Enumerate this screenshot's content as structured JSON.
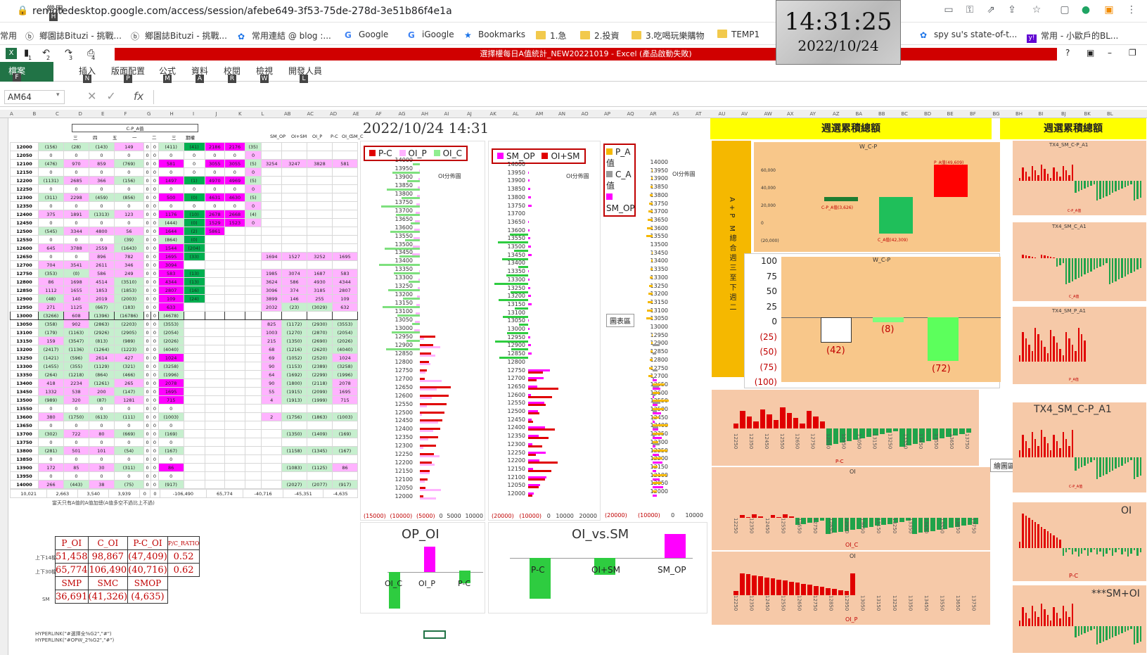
{
  "browser": {
    "url": "remotedesktop.google.com/access/session/afebe649-3f53-75de-278d-3e51b86f4e1a"
  },
  "bookmarks": [
    {
      "label": "常用",
      "icon": "none"
    },
    {
      "label": "鄉園誌Bituzi - 挑戰...",
      "icon": "logo-icon"
    },
    {
      "label": "鄉園誌Bituzi - 挑戰...",
      "icon": "logo-icon"
    },
    {
      "label": "常用連結 @ blog :...",
      "icon": "gear-icon"
    },
    {
      "label": "Google",
      "icon": "google-icon"
    },
    {
      "label": "iGoogle",
      "icon": "google-icon"
    },
    {
      "label": "Bookmarks",
      "icon": "star-icon"
    },
    {
      "label": "1.急",
      "icon": "folder-icon"
    },
    {
      "label": "2.投資",
      "icon": "folder-icon"
    },
    {
      "label": "3.吃喝玩樂購物",
      "icon": "folder-icon"
    },
    {
      "label": "TEMP1",
      "icon": "folder-icon"
    },
    {
      "label": "spy su's state-of-t...",
      "icon": "gear-icon"
    },
    {
      "label": "常用 - 小歐戶的BL...",
      "icon": "yahoo-icon"
    }
  ],
  "clock": {
    "time": "14:31:25",
    "date": "2022/10/24"
  },
  "excel": {
    "title": "選擇權每日A值統計_NEW20221019 - Excel (產品啟動失敗)",
    "qat": [
      "1",
      "2",
      "3",
      "4"
    ],
    "tabs": [
      {
        "label": "檔案",
        "key": "F"
      },
      {
        "label": "常用",
        "key": "H"
      },
      {
        "label": "插入",
        "key": "N"
      },
      {
        "label": "版面配置",
        "key": "P"
      },
      {
        "label": "公式",
        "key": "M"
      },
      {
        "label": "資料",
        "key": "A"
      },
      {
        "label": "校閱",
        "key": "R"
      },
      {
        "label": "檢視",
        "key": "W"
      },
      {
        "label": "開發人員",
        "key": "L"
      }
    ],
    "namebox": "AM64",
    "fx": "fx",
    "col_headers": [
      "A",
      "B",
      "C",
      "D",
      "E",
      "F",
      "G",
      "H",
      "I",
      "J",
      "K",
      "L",
      "AB",
      "AC",
      "AD",
      "AE",
      "AF",
      "AG",
      "AH",
      "AI",
      "AJ",
      "AK",
      "AL",
      "AM",
      "AN",
      "AO",
      "AP",
      "AQ",
      "AR",
      "AS",
      "AT",
      "AU",
      "AV",
      "AW",
      "AX",
      "AY",
      "AZ",
      "BA",
      "BB",
      "BC",
      "BD",
      "BE",
      "BF",
      "BG",
      "BH",
      "BI",
      "BJ",
      "BK",
      "BL"
    ]
  },
  "sheet": {
    "header_labels": [
      "C-P_A值",
      "三",
      "四",
      "五",
      "一",
      "二",
      "三",
      "期權",
      "SM_OP",
      "OI+SM",
      "OI_P",
      "P-C",
      "OI_C",
      "SM_C"
    ],
    "rows": [
      [
        "12000",
        "(156)",
        "(28)",
        "(143)",
        "149",
        "0",
        "0",
        "(411)",
        "(41)",
        "2186",
        "2176",
        "(35)",
        "",
        "",
        "",
        ""
      ],
      [
        "12050",
        "0",
        "0",
        "0",
        "0",
        "0",
        "0",
        "0",
        "0",
        "0",
        "0",
        "0",
        "",
        "",
        "",
        ""
      ],
      [
        "12100",
        "(476)",
        "970",
        "859",
        "(769)",
        "0",
        "0",
        "581",
        "0",
        "3055",
        "3055",
        "(5)",
        "3254",
        "3247",
        "3828",
        "581"
      ],
      [
        "12150",
        "0",
        "0",
        "0",
        "0",
        "0",
        "0",
        "0",
        "0",
        "0",
        "0",
        "0",
        "",
        "",
        "",
        ""
      ],
      [
        "12200",
        "(1131)",
        "2685",
        "366",
        "(156)",
        "0",
        "0",
        "1497",
        "(1)",
        "4970",
        "4969",
        "(5)",
        "",
        "",
        "",
        ""
      ],
      [
        "12250",
        "0",
        "0",
        "0",
        "0",
        "0",
        "0",
        "0",
        "0",
        "0",
        "0",
        "0",
        "",
        "",
        "",
        ""
      ],
      [
        "12300",
        "(311)",
        "2298",
        "(459)",
        "(856)",
        "0",
        "0",
        "500",
        "(0)",
        "4631",
        "4630",
        "(5)",
        "",
        "",
        "",
        ""
      ],
      [
        "12350",
        "0",
        "0",
        "0",
        "0",
        "0",
        "0",
        "0",
        "0",
        "0",
        "0",
        "0",
        "",
        "",
        "",
        ""
      ],
      [
        "12400",
        "375",
        "1891",
        "(1313)",
        "123",
        "0",
        "0",
        "1176",
        "(10)",
        "2678",
        "2668",
        "(4)",
        "",
        "",
        "",
        ""
      ],
      [
        "12450",
        "0",
        "0",
        "0",
        "0",
        "0",
        "0",
        "(444)",
        "(0)",
        "1529",
        "1523",
        "0",
        "",
        "",
        "",
        ""
      ],
      [
        "12500",
        "(545)",
        "3344",
        "4800",
        "56",
        "0",
        "0",
        "1644",
        "(2)",
        "5861",
        "",
        "",
        "",
        "",
        "",
        ""
      ],
      [
        "12550",
        "0",
        "0",
        "0",
        "(39)",
        "0",
        "0",
        "(864)",
        "(0)",
        "",
        "",
        "",
        "",
        "",
        "",
        ""
      ],
      [
        "12600",
        "645",
        "3788",
        "2559",
        "(1643)",
        "0",
        "0",
        "1544",
        "(204)",
        "",
        "",
        "",
        "",
        "",
        "",
        ""
      ],
      [
        "12650",
        "0",
        "0",
        "896",
        "782",
        "0",
        "0",
        "1695",
        "(33)",
        "",
        "",
        "",
        "1694",
        "1527",
        "3252",
        "1695"
      ],
      [
        "12700",
        "704",
        "3541",
        "2611",
        "346",
        "0",
        "0",
        "3094",
        "",
        "",
        "",
        "",
        "",
        "",
        "",
        ""
      ],
      [
        "12750",
        "(353)",
        "(0)",
        "586",
        "249",
        "0",
        "0",
        "583",
        "(13)",
        "",
        "",
        "",
        "1985",
        "3074",
        "1687",
        "583"
      ],
      [
        "12800",
        "86",
        "1698",
        "4514",
        "(3510)",
        "0",
        "0",
        "4344",
        "(13)",
        "",
        "",
        "",
        "3624",
        "586",
        "4930",
        "4344"
      ],
      [
        "12850",
        "1112",
        "1655",
        "1853",
        "(1853)",
        "0",
        "0",
        "2807",
        "(16)",
        "",
        "",
        "",
        "3096",
        "374",
        "3185",
        "2807"
      ],
      [
        "12900",
        "(48)",
        "140",
        "2019",
        "(2003)",
        "0",
        "0",
        "109",
        "(24)",
        "",
        "",
        "",
        "3899",
        "146",
        "255",
        "109"
      ],
      [
        "12950",
        "271",
        "1125",
        "(667)",
        "(183)",
        "0",
        "0",
        "633",
        "",
        "",
        "",
        "",
        "2032",
        "(23)",
        "(3029)",
        "632"
      ],
      [
        "13000",
        "(3266)",
        "608",
        "(1396)",
        "(16786)",
        "0",
        "0",
        "(4678)",
        "",
        "",
        "",
        "",
        "",
        "",
        "",
        ""
      ],
      [
        "13050",
        "(358)",
        "902",
        "(2863)",
        "(2203)",
        "0",
        "0",
        "(3553)",
        "",
        "",
        "",
        "",
        "825",
        "(1172)",
        "(2930)",
        "(3553)"
      ],
      [
        "13100",
        "(179)",
        "(1163)",
        "(2926)",
        "(2905)",
        "0",
        "0",
        "(2054)",
        "",
        "",
        "",
        "",
        "1003",
        "(1270)",
        "(2870)",
        "(2054)"
      ],
      [
        "13150",
        "159",
        "(3547)",
        "(813)",
        "(989)",
        "0",
        "0",
        "(2026)",
        "",
        "",
        "",
        "",
        "215",
        "(1350)",
        "(2690)",
        "(2026)"
      ],
      [
        "13200",
        "(2417)",
        "(1136)",
        "(1264)",
        "(1223)",
        "0",
        "0",
        "(4040)",
        "",
        "",
        "",
        "",
        "68",
        "(1216)",
        "(2620)",
        "(4040)"
      ],
      [
        "13250",
        "(1421)",
        "(596)",
        "2614",
        "427",
        "0",
        "0",
        "1024",
        "",
        "",
        "",
        "",
        "69",
        "(1052)",
        "(2520)",
        "1024"
      ],
      [
        "13300",
        "(1455)",
        "(355)",
        "(1129)",
        "(321)",
        "0",
        "0",
        "(3258)",
        "",
        "",
        "",
        "",
        "90",
        "(1153)",
        "(2389)",
        "(3258)"
      ],
      [
        "13350",
        "(264)",
        "(1218)",
        "(864)",
        "(466)",
        "0",
        "0",
        "(1996)",
        "",
        "",
        "",
        "",
        "64",
        "(1692)",
        "(2299)",
        "(1996)"
      ],
      [
        "13400",
        "418",
        "2234",
        "(1261)",
        "265",
        "0",
        "0",
        "2078",
        "",
        "",
        "",
        "",
        "90",
        "(1800)",
        "(2118)",
        "2078"
      ],
      [
        "13450",
        "1332",
        "538",
        "200",
        "(147)",
        "0",
        "0",
        "1695",
        "",
        "",
        "",
        "",
        "55",
        "(1915)",
        "(2099)",
        "1695"
      ],
      [
        "13500",
        "(989)",
        "320",
        "(87)",
        "1281",
        "0",
        "0",
        "715",
        "",
        "",
        "",
        "",
        "4",
        "(1913)",
        "(1999)",
        "715"
      ],
      [
        "13550",
        "0",
        "0",
        "0",
        "0",
        "0",
        "0",
        "0",
        "",
        "",
        "",
        "",
        "",
        "",
        "",
        ""
      ],
      [
        "13600",
        "380",
        "(1750)",
        "(613)",
        "(111)",
        "0",
        "0",
        "(1003)",
        "",
        "",
        "",
        "",
        "2",
        "(1756)",
        "(1863)",
        "(1003)"
      ],
      [
        "13650",
        "0",
        "0",
        "0",
        "0",
        "0",
        "0",
        "0",
        "",
        "",
        "",
        "",
        "",
        "",
        "",
        ""
      ],
      [
        "13700",
        "(302)",
        "722",
        "80",
        "(669)",
        "0",
        "0",
        "(169)",
        "",
        "",
        "",
        "",
        "",
        "(1350)",
        "(1409)",
        "(169)"
      ],
      [
        "13750",
        "0",
        "0",
        "0",
        "0",
        "0",
        "0",
        "0",
        "",
        "",
        "",
        "",
        "",
        "",
        "",
        ""
      ],
      [
        "13800",
        "(281)",
        "501",
        "101",
        "(54)",
        "0",
        "0",
        "(167)",
        "",
        "",
        "",
        "",
        "",
        "(1158)",
        "(1345)",
        "(167)"
      ],
      [
        "13850",
        "0",
        "0",
        "0",
        "0",
        "0",
        "0",
        "0",
        "",
        "",
        "",
        "",
        "",
        "",
        "",
        ""
      ],
      [
        "13900",
        "172",
        "85",
        "30",
        "(311)",
        "0",
        "0",
        "86",
        "",
        "",
        "",
        "",
        "",
        "(1083)",
        "(1125)",
        "86"
      ],
      [
        "13950",
        "0",
        "0",
        "0",
        "0",
        "0",
        "0",
        "0",
        "",
        "",
        "",
        "",
        "",
        "",
        "",
        ""
      ],
      [
        "14000",
        "266",
        "(443)",
        "38",
        "(75)",
        "0",
        "0",
        "(917)",
        "",
        "",
        "",
        "",
        "",
        "(2027)",
        "(2077)",
        "(917)"
      ]
    ],
    "totals": [
      "10,021",
      "2,663",
      "3,540",
      "3,939",
      "0",
      "0",
      "-106,490",
      "65,774",
      "-40,716",
      "-45,351",
      "-4,635"
    ],
    "note": "當天只有A值的A值加總(A值多空不過比上不過)",
    "hyperlink1": "HYPERLINK(\"#選擇全%G2\",\"#\")",
    "hyperlink2": "HYPERLINK(\"#OPW_2%G2\",\"#\")"
  },
  "summary": {
    "headers": [
      "P_OI",
      "C_OI",
      "P-C_OI",
      "P/C_RATIO"
    ],
    "rows": [
      {
        "label": "上下14檔",
        "values": [
          "51,458",
          "98,867",
          "(47,409)",
          "0.52"
        ]
      },
      {
        "label": "上下30檔",
        "values": [
          "65,774",
          "106,490",
          "(40,716)",
          "0.62"
        ]
      }
    ],
    "sm_headers": [
      "SMP",
      "SMC",
      "SMOP"
    ],
    "sm_label": "SM",
    "sm_values": [
      "36,691",
      "(41,326)",
      "(4,635)"
    ]
  },
  "charts": {
    "datetime": "2022/10/24 14:31",
    "oi_legend": [
      "P-C",
      "OI_P",
      "OI_C"
    ],
    "oi_title": "OI分佈圖",
    "sm_legend": [
      "SM_OP",
      "OI+SM"
    ],
    "pa_legend": [
      "P_A值",
      "C_A值",
      "SM_OP"
    ],
    "strikes": [
      "14000",
      "13950",
      "13900",
      "13850",
      "13800",
      "13750",
      "13700",
      "13650",
      "13600",
      "13550",
      "13500",
      "13450",
      "13400",
      "13350",
      "13300",
      "13250",
      "13200",
      "13150",
      "13100",
      "13050",
      "13000",
      "12950",
      "12900",
      "12850",
      "12800",
      "12750",
      "12700",
      "12650",
      "12600",
      "12550",
      "12500",
      "12450",
      "12400",
      "12350",
      "12300",
      "12250",
      "12200",
      "12150",
      "12100",
      "12050",
      "12000"
    ],
    "oi_axis": [
      "(15000)",
      "(10000)",
      "(5000)",
      "0",
      "5000",
      "10000"
    ],
    "sm_axis": [
      "(20000)",
      "(10000)",
      "0",
      "10000",
      "20000"
    ],
    "pa_axis": [
      "(20000)",
      "(10000)",
      "0",
      "10000"
    ],
    "chart_area_label": "圖表區",
    "op_oi_title": "OP_OI",
    "op_oi_labels": [
      "OI_C",
      "OI_P",
      "P-C"
    ],
    "oi_vs_sm_title": "OI_vs.SM",
    "oi_vs_sm_labels": [
      "P-C",
      "OI+SM",
      "SM_OP"
    ],
    "week_title": "週選累積總額",
    "week_title2": "週選累積總額",
    "side_label": "A+P M總合週三至下週二",
    "wcp_title": "W_C-P",
    "wcp_labels": [
      "C-P_A值(3,626)",
      "C_A值(42,309)",
      "P_A值(49,609)"
    ],
    "small_axis": [
      "60,000",
      "40,000",
      "20,000",
      "0",
      "(20,000)",
      "(40,000)",
      "(60,000)"
    ],
    "wcp2_title": "W_C-P",
    "wcp2_axis": [
      "100",
      "75",
      "50",
      "25",
      "0",
      "(25)",
      "(50)",
      "(75)",
      "(100)"
    ],
    "wcp2_values": [
      "(42)",
      "(8)",
      "(72)"
    ],
    "right_titles": [
      "TX4_SM_C-P_A1",
      "TX4_SM_C_A1",
      "TX4_SM_P_A1",
      "TX4_SM_C-P_A1",
      "OI",
      "***SM+OI"
    ],
    "right_legends": [
      "C-P_A值",
      "C_A值",
      "P_A值",
      "C-P_A值",
      "P-C",
      ""
    ],
    "mid_titles": [
      "",
      "OI",
      "OI"
    ],
    "mid_legends": [
      "P-C",
      "OI_C",
      "OI_P"
    ],
    "mid_ticks": [
      "12250",
      "12300",
      "12350",
      "12400",
      "12450",
      "12500",
      "12550",
      "12600",
      "12650",
      "12700",
      "12750",
      "12800",
      "12850",
      "12900",
      "12950",
      "13000",
      "13050",
      "13100",
      "13150",
      "13200",
      "13250",
      "13300",
      "13350",
      "13400",
      "13450",
      "13500",
      "13550",
      "13600",
      "13650",
      "13700",
      "13750"
    ],
    "chart_area_label2": "繪圖區"
  },
  "colors": {
    "red": "#e00000",
    "green": "#00b050",
    "magenta": "#ff00ff",
    "yellow": "#ffff00",
    "orange": "#f5b800",
    "tan": "#f6c9a8"
  }
}
